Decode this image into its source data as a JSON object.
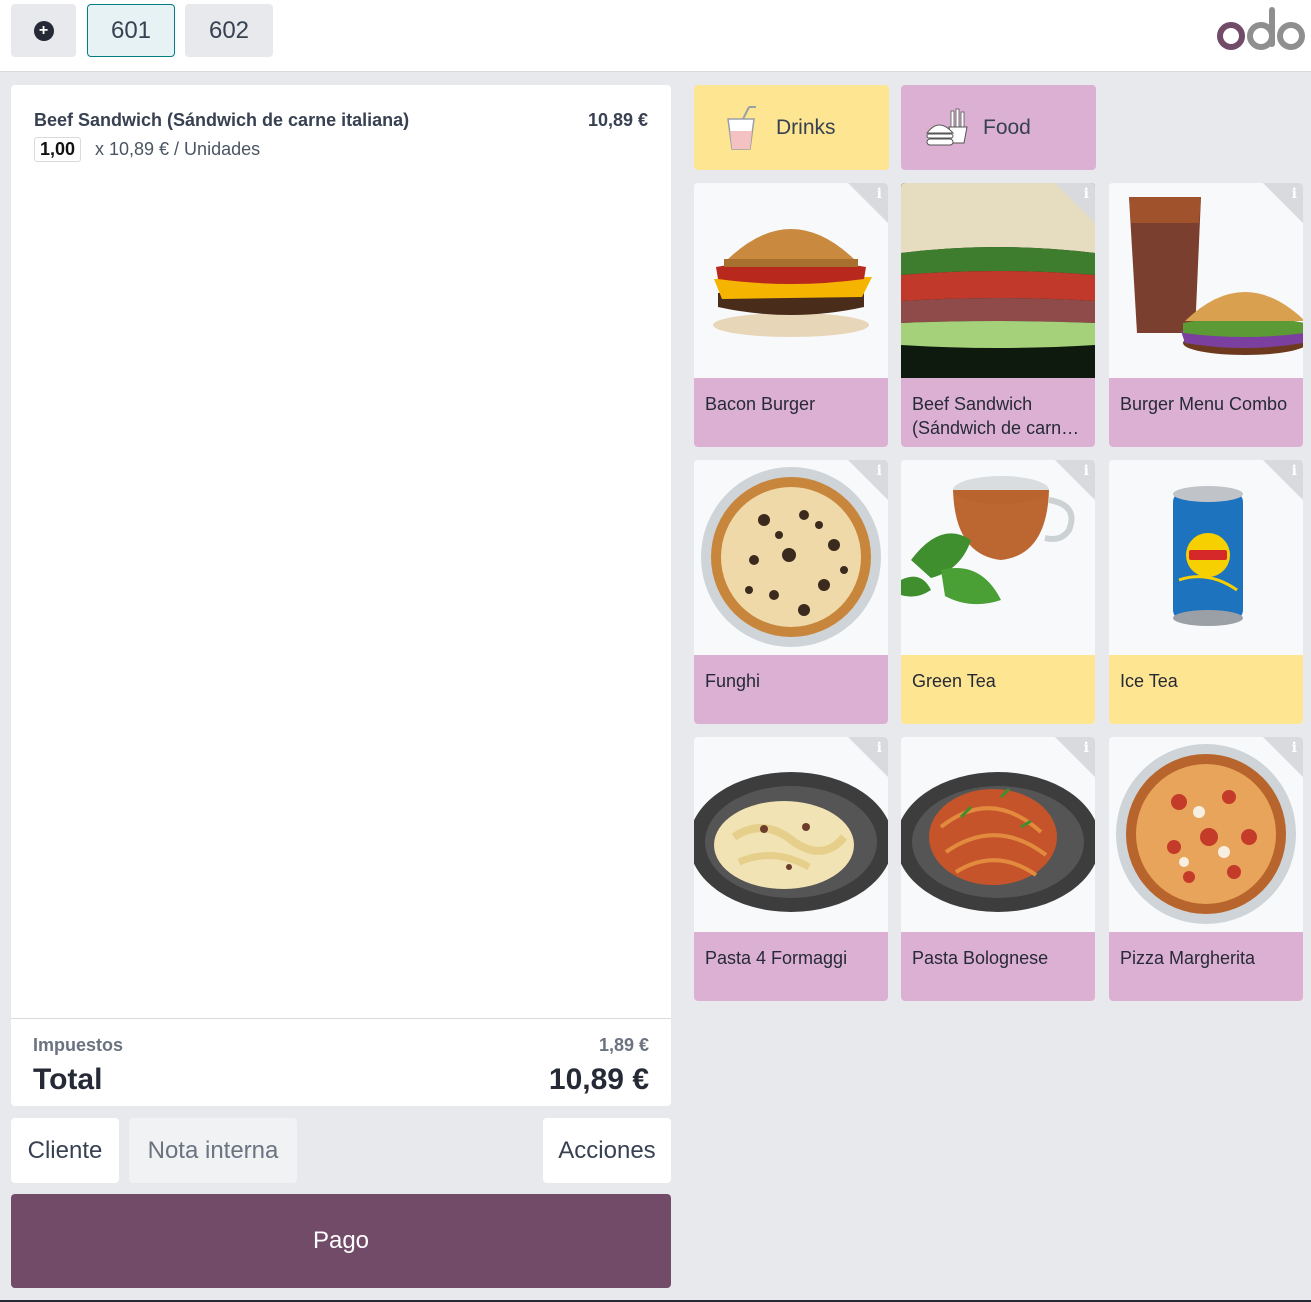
{
  "topbar": {
    "add_icon": "plus-circle-icon",
    "orders": [
      {
        "label": "601",
        "active": true
      },
      {
        "label": "602",
        "active": false
      }
    ],
    "logo": "odo",
    "logo_color": "#714b67"
  },
  "order": {
    "lines": [
      {
        "name": "Beef Sandwich (Sándwich de carne italiana)",
        "price": "10,89 €",
        "qty": "1,00",
        "unit_info": "x 10,89 € / Unidades"
      }
    ],
    "tax_label": "Impuestos",
    "tax_value": "1,89 €",
    "total_label": "Total",
    "total_value": "10,89 €"
  },
  "actions": {
    "customer": "Cliente",
    "note_placeholder": "Nota interna",
    "more": "Acciones",
    "pay": "Pago"
  },
  "categories": [
    {
      "label": "Drinks",
      "icon": "drink-cup-icon",
      "color": "#fde592"
    },
    {
      "label": "Food",
      "icon": "burger-fries-icon",
      "color": "#dcb0d3"
    }
  ],
  "products": [
    {
      "name": "Bacon Burger",
      "image": "burger-image",
      "color": "#dcb0d3"
    },
    {
      "name": "Beef Sandwich (Sándwich de carne italiana)",
      "image": "sandwich-image",
      "color": "#dcb0d3"
    },
    {
      "name": "Burger Menu Combo",
      "image": "combo-image",
      "color": "#dcb0d3"
    },
    {
      "name": "Funghi",
      "image": "pizza-funghi-image",
      "color": "#dcb0d3"
    },
    {
      "name": "Green Tea",
      "image": "tea-cup-image",
      "color": "#fde592"
    },
    {
      "name": "Ice Tea",
      "image": "ice-tea-can-image",
      "color": "#fde592"
    },
    {
      "name": "Pasta 4 Formaggi",
      "image": "pasta-image",
      "color": "#dcb0d3"
    },
    {
      "name": "Pasta Bolognese",
      "image": "spaghetti-image",
      "color": "#dcb0d3"
    },
    {
      "name": "Pizza Margherita",
      "image": "pizza-margherita-image",
      "color": "#dcb0d3"
    }
  ],
  "colors": {
    "primary": "#714b67",
    "accent": "#017e84",
    "background": "#e7e9ed"
  }
}
